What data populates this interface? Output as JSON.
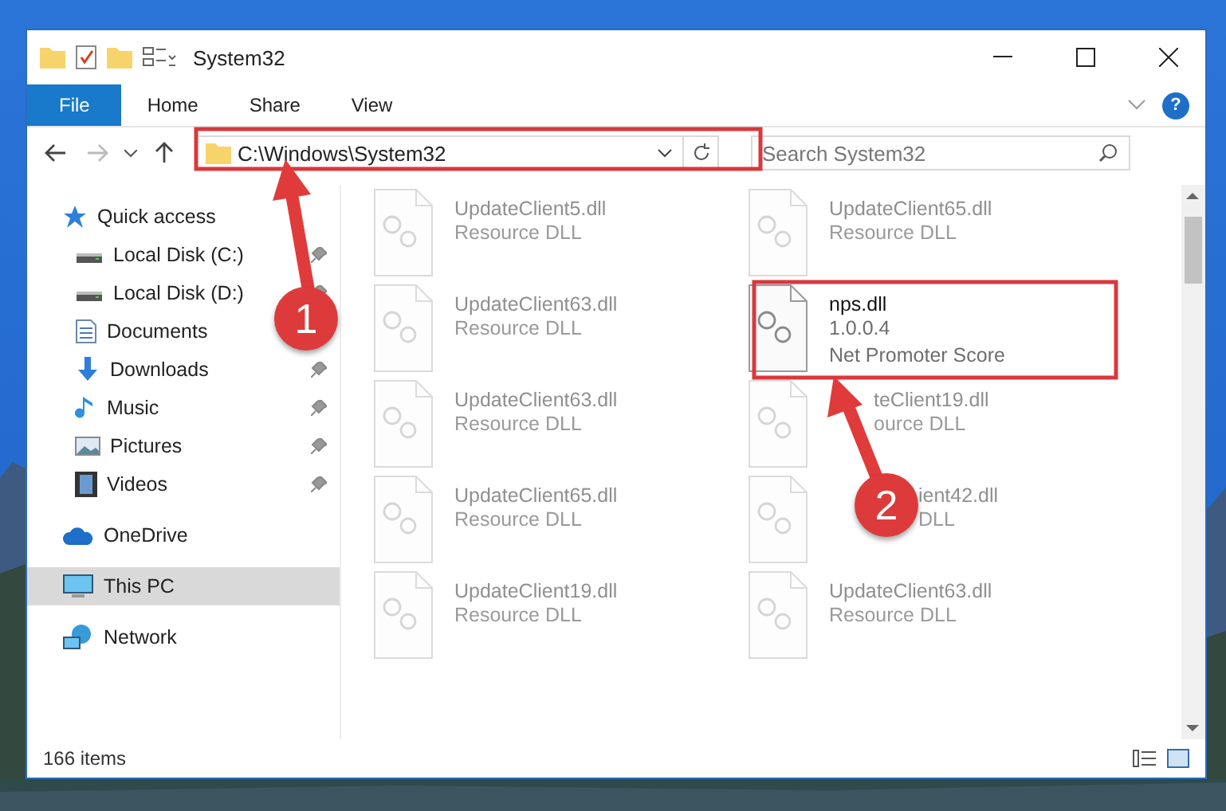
{
  "window": {
    "title": "System32",
    "help": "?"
  },
  "ribbon": {
    "tabs": [
      {
        "label": "File",
        "kind": "file"
      },
      {
        "label": "Home",
        "kind": "tab"
      },
      {
        "label": "Share",
        "kind": "tab"
      },
      {
        "label": "View",
        "kind": "tab"
      }
    ]
  },
  "address": {
    "path": "C:\\Windows\\System32",
    "search_placeholder": "Search System32"
  },
  "sidebar": {
    "items": [
      {
        "label": "Quick access",
        "selected": false,
        "children": [
          {
            "label": "Local Disk (C:)",
            "pinned": true,
            "selected": false
          },
          {
            "label": "Local Disk (D:)",
            "pinned": true,
            "selected": false
          },
          {
            "label": "Documents",
            "pinned": false,
            "selected": false
          },
          {
            "label": "Downloads",
            "pinned": true,
            "selected": false
          },
          {
            "label": "Music",
            "pinned": true,
            "selected": false
          },
          {
            "label": "Pictures",
            "pinned": true,
            "selected": false
          },
          {
            "label": "Videos",
            "pinned": true,
            "selected": false
          }
        ]
      },
      {
        "label": "OneDrive",
        "selected": false
      },
      {
        "label": "This PC",
        "selected": true
      },
      {
        "label": "Network",
        "selected": false
      }
    ]
  },
  "files": [
    {
      "name": "UpdateClient5.dll",
      "lines": [
        "Resource DLL"
      ],
      "kind": "faded"
    },
    {
      "name": "UpdateClient65.dll",
      "lines": [
        "Resource DLL"
      ],
      "kind": "faded"
    },
    {
      "name": "UpdateClient63.dll",
      "lines": [
        "Resource DLL"
      ],
      "kind": "faded"
    },
    {
      "name": "nps.dll",
      "lines": [
        "1.0.0.4",
        "Net Promoter Score"
      ],
      "kind": "focus"
    },
    {
      "name": "UpdateClient63.dll",
      "lines": [
        "Resource DLL"
      ],
      "kind": "faded"
    },
    {
      "name": "teClient19.dll",
      "lines": [
        "ource DLL"
      ],
      "kind": "under_arrow"
    },
    {
      "name": "UpdateClient65.dll",
      "lines": [
        "Resource DLL"
      ],
      "kind": "faded"
    },
    {
      "name": "ient42.dll",
      "lines": [
        "DLL"
      ],
      "kind": "under_badge"
    },
    {
      "name": "UpdateClient19.dll",
      "lines": [
        "Resource DLL"
      ],
      "kind": "faded"
    },
    {
      "name": "UpdateClient63.dll",
      "lines": [
        "Resource DLL"
      ],
      "kind": "faded"
    }
  ],
  "status_bar": {
    "count": "166 items"
  },
  "annotations": [
    {
      "label": "1"
    },
    {
      "label": "2"
    }
  ]
}
